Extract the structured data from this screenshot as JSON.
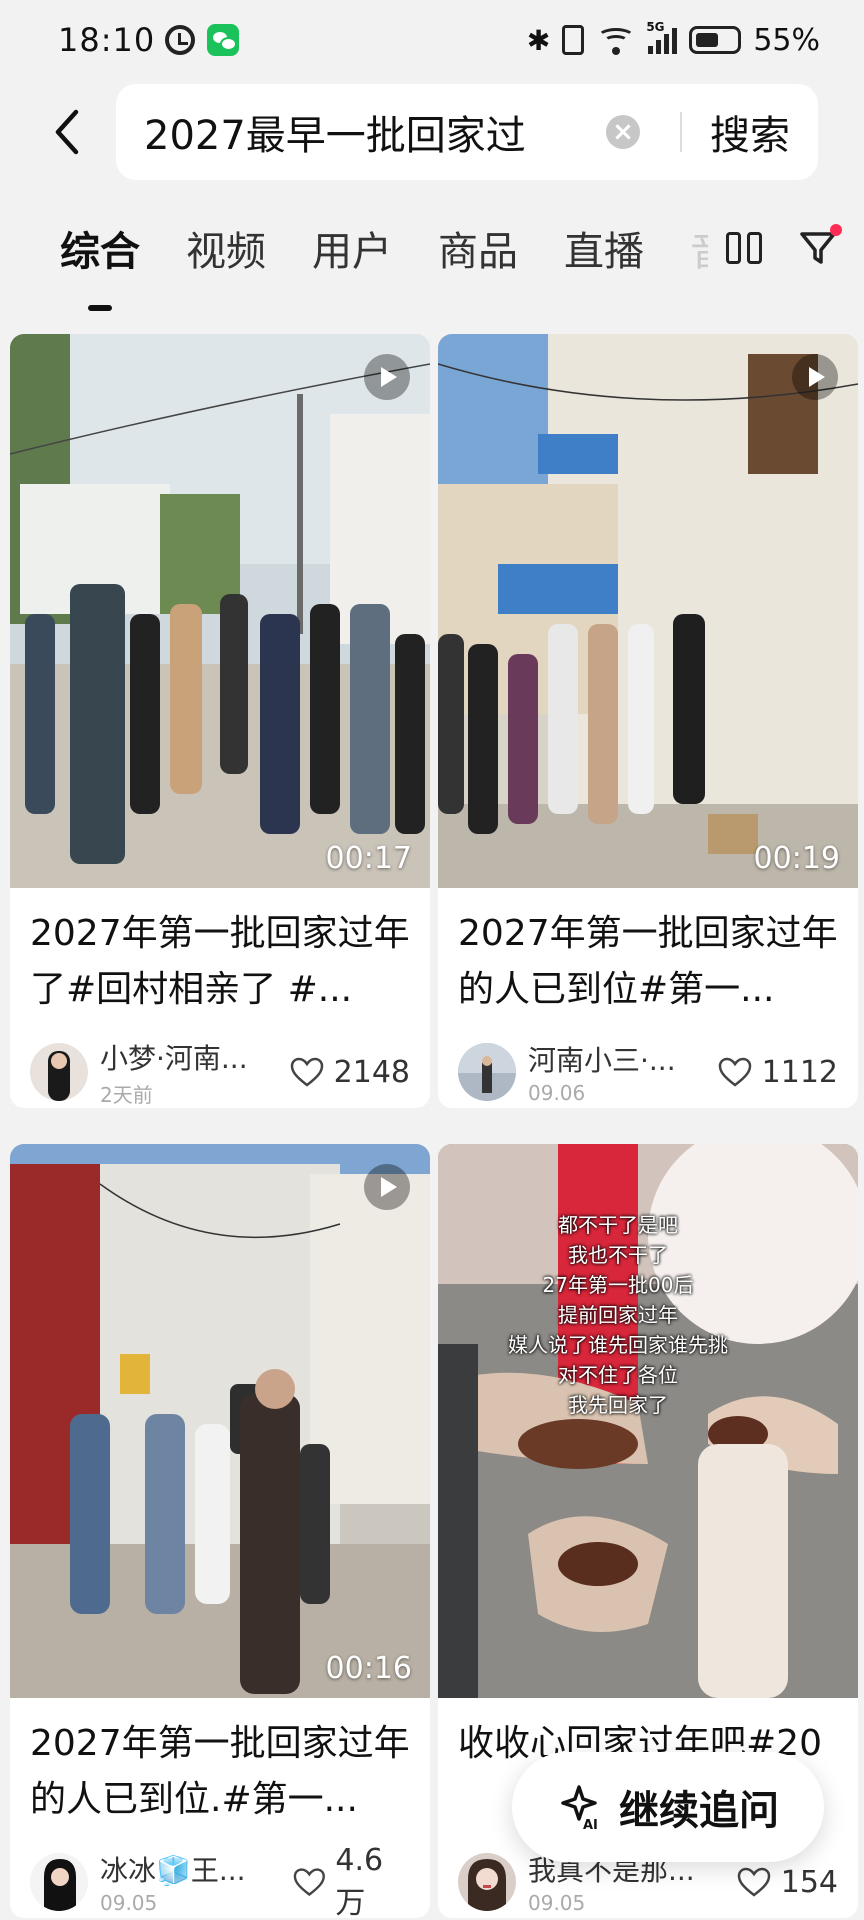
{
  "status_bar": {
    "time": "18:10",
    "battery": "55%",
    "net": "5G",
    "sim": "6"
  },
  "search": {
    "query": "2027最早一批回家过",
    "button": "搜索"
  },
  "tabs": [
    {
      "label": "综合",
      "active": true
    },
    {
      "label": "视频"
    },
    {
      "label": "用户"
    },
    {
      "label": "商品"
    },
    {
      "label": "直播"
    }
  ],
  "cards": [
    {
      "title": "2027年第一批回家过年了#回村相亲了 #...",
      "duration": "00:17",
      "author": "小梦·河南...",
      "date": "2天前",
      "likes": "2148"
    },
    {
      "title": "2027年第一批回家过年的人已到位#第一...",
      "duration": "00:19",
      "author": "河南小三·...",
      "date": "09.06",
      "likes": "1112"
    },
    {
      "title": "2027年第一批回家过年的人已到位.#第一...",
      "duration": "00:16",
      "author": "冰冰🧊王...",
      "date": "09.05",
      "likes": "4.6万"
    },
    {
      "title": "收收心回家过年吧#20",
      "duration": "",
      "author": "我真不是那...",
      "date": "09.05",
      "likes": "154",
      "overlay": [
        "都不干了是吧",
        "我也不干了",
        "27年第一批00后",
        "提前回家过年",
        "媒人说了谁先回家谁先挑",
        "对不住了各位",
        "我先回家了"
      ]
    }
  ],
  "float_button": {
    "label": "继续追问",
    "icon": "ai-sparkle-icon"
  },
  "colors": {
    "accent": "#ff2d55",
    "background": "#f2f2f2"
  }
}
